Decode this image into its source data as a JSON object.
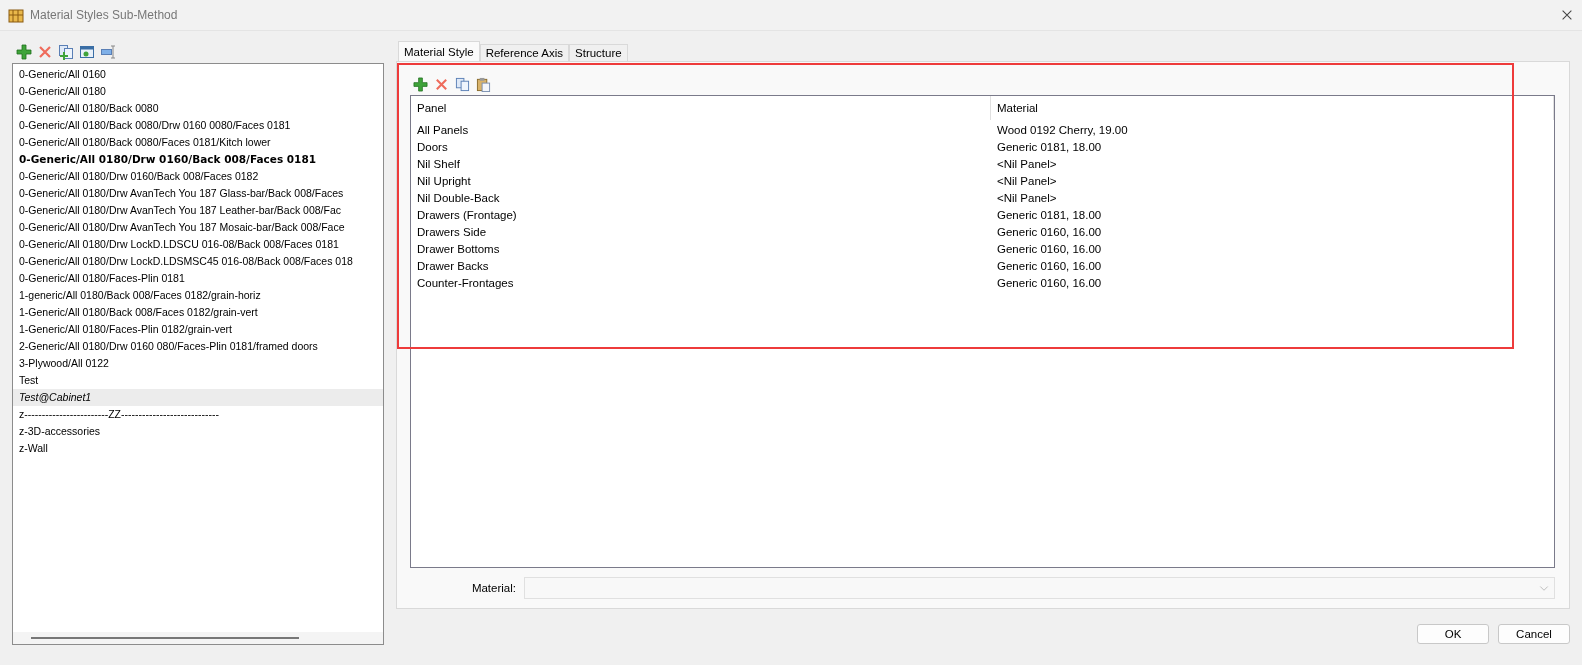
{
  "window": {
    "title": "Material Styles Sub-Method"
  },
  "style_list": {
    "items": [
      {
        "text": "0-Generic/All 0160",
        "kind": "plain",
        "selected": false
      },
      {
        "text": "0-Generic/All 0180",
        "kind": "plain",
        "selected": false
      },
      {
        "text": "0-Generic/All 0180/Back 0080",
        "kind": "plain",
        "selected": false
      },
      {
        "text": "0-Generic/All 0180/Back 0080/Drw 0160 0080/Faces 0181",
        "kind": "plain",
        "selected": false
      },
      {
        "text": "0-Generic/All 0180/Back 0080/Faces 0181/Kitch lower",
        "kind": "plain",
        "selected": false
      },
      {
        "text": "0-Generic/All 0180/Drw 0160/Back 008/Faces 0181",
        "kind": "default",
        "selected": false
      },
      {
        "text": "0-Generic/All 0180/Drw 0160/Back 008/Faces 0182",
        "kind": "plain",
        "selected": false
      },
      {
        "text": "0-Generic/All 0180/Drw AvanTech You 187 Glass-bar/Back 008/Faces",
        "kind": "plain",
        "selected": false
      },
      {
        "text": "0-Generic/All 0180/Drw AvanTech You 187 Leather-bar/Back 008/Fac",
        "kind": "plain",
        "selected": false
      },
      {
        "text": "0-Generic/All 0180/Drw AvanTech You 187 Mosaic-bar/Back 008/Face",
        "kind": "plain",
        "selected": false
      },
      {
        "text": "0-Generic/All 0180/Drw LockD.LDSCU 016-08/Back 008/Faces 0181",
        "kind": "plain",
        "selected": false
      },
      {
        "text": "0-Generic/All 0180/Drw LockD.LDSMSC45 016-08/Back 008/Faces 018",
        "kind": "plain",
        "selected": false
      },
      {
        "text": "0-Generic/All 0180/Faces-Plin 0181",
        "kind": "plain",
        "selected": false
      },
      {
        "text": "1-generic/All 0180/Back 008/Faces 0182/grain-horiz",
        "kind": "plain",
        "selected": false
      },
      {
        "text": "1-Generic/All 0180/Back 008/Faces 0182/grain-vert",
        "kind": "plain",
        "selected": false
      },
      {
        "text": "1-Generic/All 0180/Faces-Plin 0182/grain-vert",
        "kind": "plain",
        "selected": false
      },
      {
        "text": "2-Generic/All 0180/Drw 0160 080/Faces-Plin 0181/framed doors",
        "kind": "plain",
        "selected": false
      },
      {
        "text": "3-Plywood/All 0122",
        "kind": "plain",
        "selected": false
      },
      {
        "text": "Test",
        "kind": "plain",
        "selected": false
      },
      {
        "text": "Test@Cabinet1",
        "kind": "linked",
        "selected": true
      },
      {
        "text": "z------------------------ZZ----------------------------",
        "kind": "plain",
        "selected": false
      },
      {
        "text": "z-3D-accessories",
        "kind": "plain",
        "selected": false
      },
      {
        "text": "z-Wall",
        "kind": "plain",
        "selected": false
      }
    ]
  },
  "tabs": [
    {
      "label": "Material Style",
      "selected": true
    },
    {
      "label": "Reference Axis",
      "selected": false
    },
    {
      "label": "Structure",
      "selected": false
    }
  ],
  "table": {
    "columns": [
      "Panel",
      "Material"
    ],
    "rows": [
      [
        "All Panels",
        "Wood 0192 Cherry, 19.00"
      ],
      [
        "Doors",
        "Generic 0181, 18.00"
      ],
      [
        "Nil Shelf",
        "<Nil Panel>"
      ],
      [
        "Nil Upright",
        "<Nil Panel>"
      ],
      [
        "Nil Double-Back",
        "<Nil Panel>"
      ],
      [
        "Drawers (Frontage)",
        "Generic 0181, 18.00"
      ],
      [
        "Drawers Side",
        "Generic 0160, 16.00"
      ],
      [
        "Drawer Bottoms",
        "Generic 0160, 16.00"
      ],
      [
        "Drawer Backs",
        "Generic 0160, 16.00"
      ],
      [
        "Counter-Frontages",
        "Generic 0160, 16.00"
      ]
    ]
  },
  "material_field": {
    "label": "Material:",
    "disabled": true
  },
  "highlight": true,
  "buttons": [
    "OK",
    "Cancel"
  ]
}
